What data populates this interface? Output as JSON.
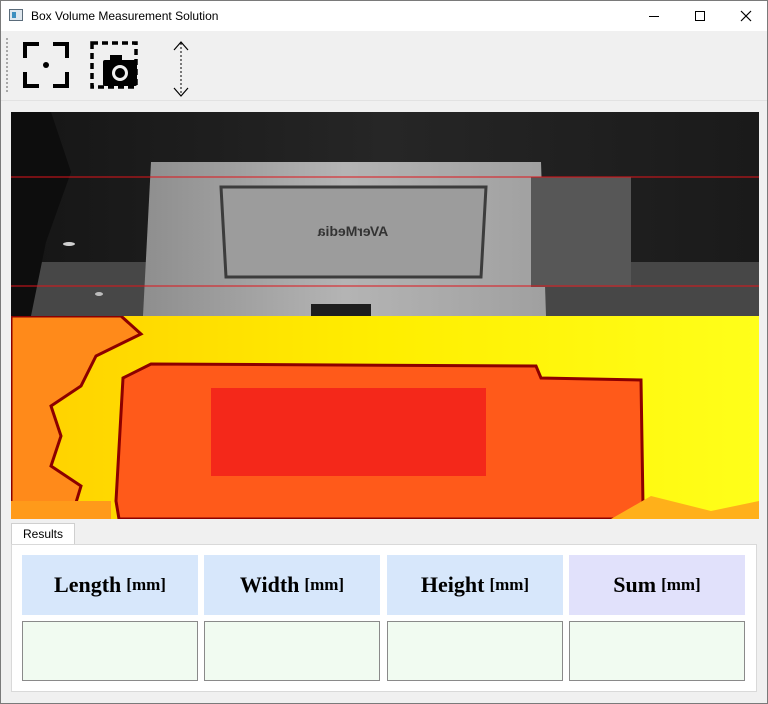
{
  "window": {
    "title": "Box Volume Measurement Solution",
    "controls": [
      "minimize-icon",
      "maximize-icon",
      "close-icon"
    ]
  },
  "toolbar": {
    "tools": [
      {
        "name": "focus-frame-icon"
      },
      {
        "name": "capture-camera-icon"
      },
      {
        "name": "vertical-arrows-icon"
      }
    ]
  },
  "camera_view": {
    "box_text": "AVerMedia",
    "guide_line_color": "#e0141a"
  },
  "depth_view": {
    "colors": {
      "far": "#ffff00",
      "mid": "#ff8a1a",
      "box": "#ff5a1a",
      "near": "#f4281a",
      "edge": "#8c0000"
    }
  },
  "results": {
    "tab_label": "Results",
    "headers": [
      {
        "label": "Length",
        "unit": "[mm]",
        "bg": "#d7e7fb"
      },
      {
        "label": "Width",
        "unit": "[mm]",
        "bg": "#d7e7fb"
      },
      {
        "label": "Height",
        "unit": "[mm]",
        "bg": "#d7e7fb"
      },
      {
        "label": "Sum",
        "unit": "[mm]",
        "bg": "#e1e1fb"
      }
    ],
    "values": [
      "",
      "",
      "",
      ""
    ]
  }
}
